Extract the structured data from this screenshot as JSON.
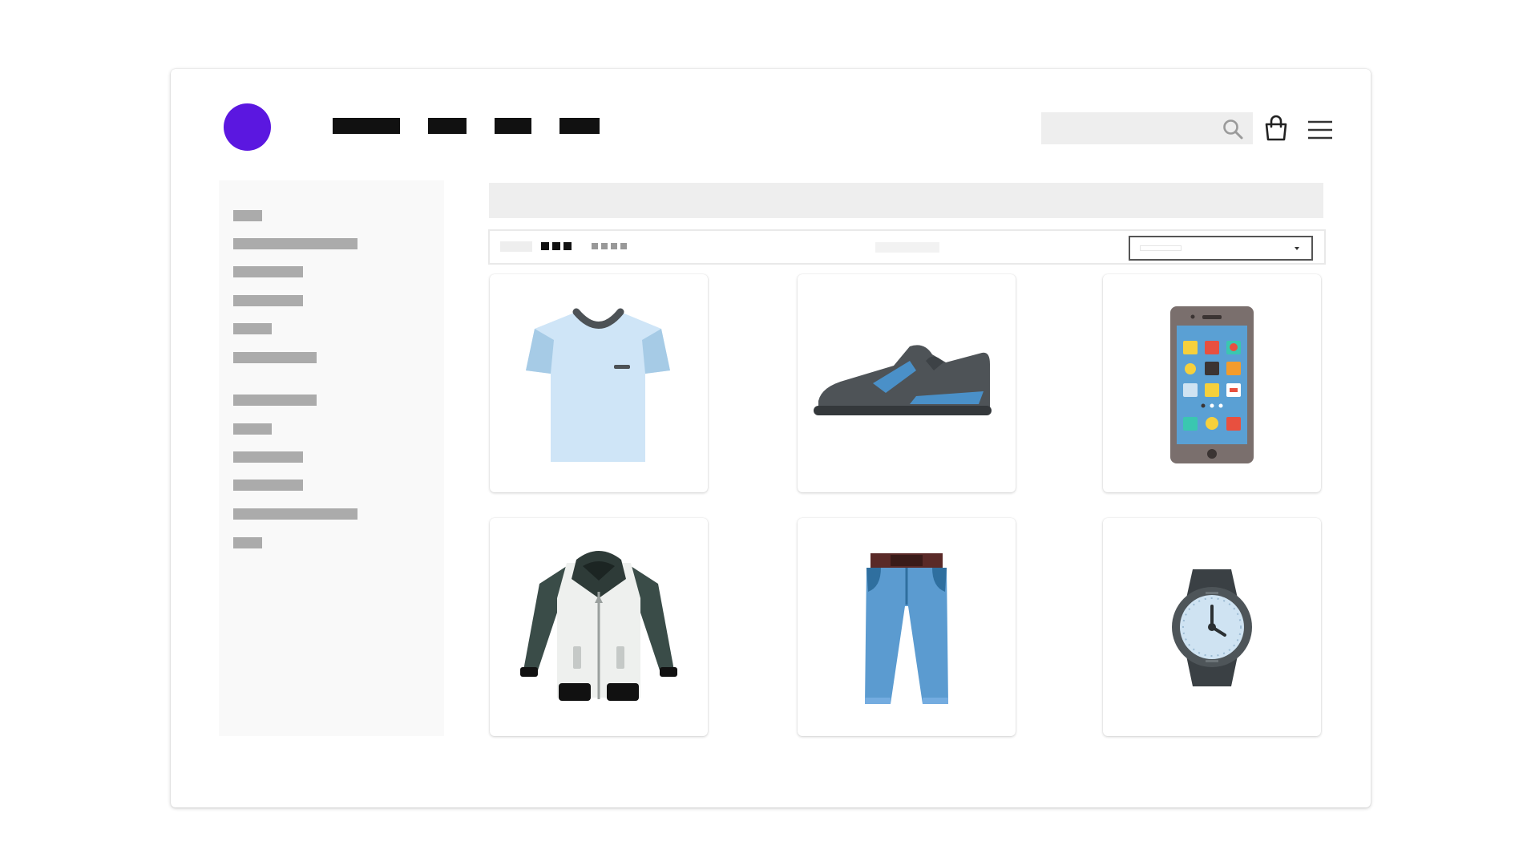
{
  "colors": {
    "brand": "#5b17e0",
    "nav_placeholder": "#111111",
    "sidebar_placeholder": "#ababab",
    "search_bg": "#eeeeee",
    "panel_bg": "#f9f9f9"
  },
  "header": {
    "logo": "brand-logo-circle",
    "nav_items": [
      "nav-link-1",
      "nav-link-2",
      "nav-link-3",
      "nav-link-4"
    ],
    "search": {
      "value": "",
      "placeholder": ""
    },
    "icons": [
      "search-icon",
      "shopping-bag-icon",
      "hamburger-menu-icon"
    ]
  },
  "sidebar": {
    "filter_count": 12,
    "group_sizes": [
      6,
      6
    ]
  },
  "toolbar": {
    "view_options": [
      "grid-view",
      "three-column-view",
      "four-column-view"
    ],
    "selected_view": "three-column-view",
    "sort_select": {
      "value": ""
    }
  },
  "products": [
    {
      "icon": "t-shirt-icon"
    },
    {
      "icon": "sneaker-icon"
    },
    {
      "icon": "smartphone-icon"
    },
    {
      "icon": "bomber-jacket-icon"
    },
    {
      "icon": "jeans-icon"
    },
    {
      "icon": "wristwatch-icon"
    }
  ]
}
